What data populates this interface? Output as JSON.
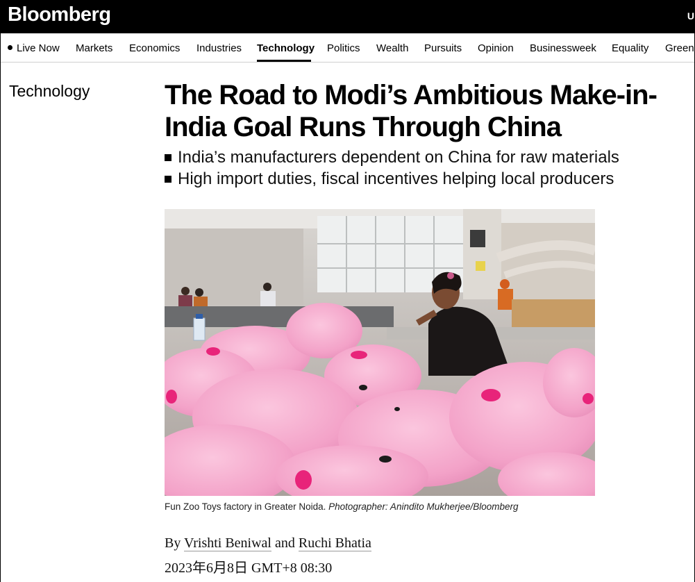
{
  "header": {
    "logo": "Bloomberg",
    "edge_text": "U"
  },
  "nav": {
    "items": [
      {
        "label": "Live Now",
        "active": false
      },
      {
        "label": "Markets",
        "active": false
      },
      {
        "label": "Economics",
        "active": false
      },
      {
        "label": "Industries",
        "active": false
      },
      {
        "label": "Technology",
        "active": true
      },
      {
        "label": "Politics",
        "active": false
      },
      {
        "label": "Wealth",
        "active": false
      },
      {
        "label": "Pursuits",
        "active": false
      },
      {
        "label": "Opinion",
        "active": false
      },
      {
        "label": "Businessweek",
        "active": false
      },
      {
        "label": "Equality",
        "active": false
      },
      {
        "label": "Green",
        "active": false
      }
    ]
  },
  "article": {
    "section": "Technology",
    "headline": "The Road to Modi’s Ambitious Make-in-India Goal Runs Through China",
    "bullets": [
      "India’s manufacturers dependent on China for raw materials",
      "High import duties, fiscal incentives helping local producers"
    ],
    "caption": "Fun Zoo Toys factory in Greater Noida.",
    "credit": "Photographer: Anindito Mukherjee/Bloomberg",
    "byline_prefix": "By",
    "byline_joiner": "and",
    "authors": [
      "Vrishti Beniwal",
      "Ruchi Bhatia"
    ],
    "date": "2023年6月8日 GMT+8 08:30"
  },
  "colors": {
    "topbar": "#000000",
    "toy_pink": "#f4a6cc",
    "accent_pink": "#e8247a"
  }
}
